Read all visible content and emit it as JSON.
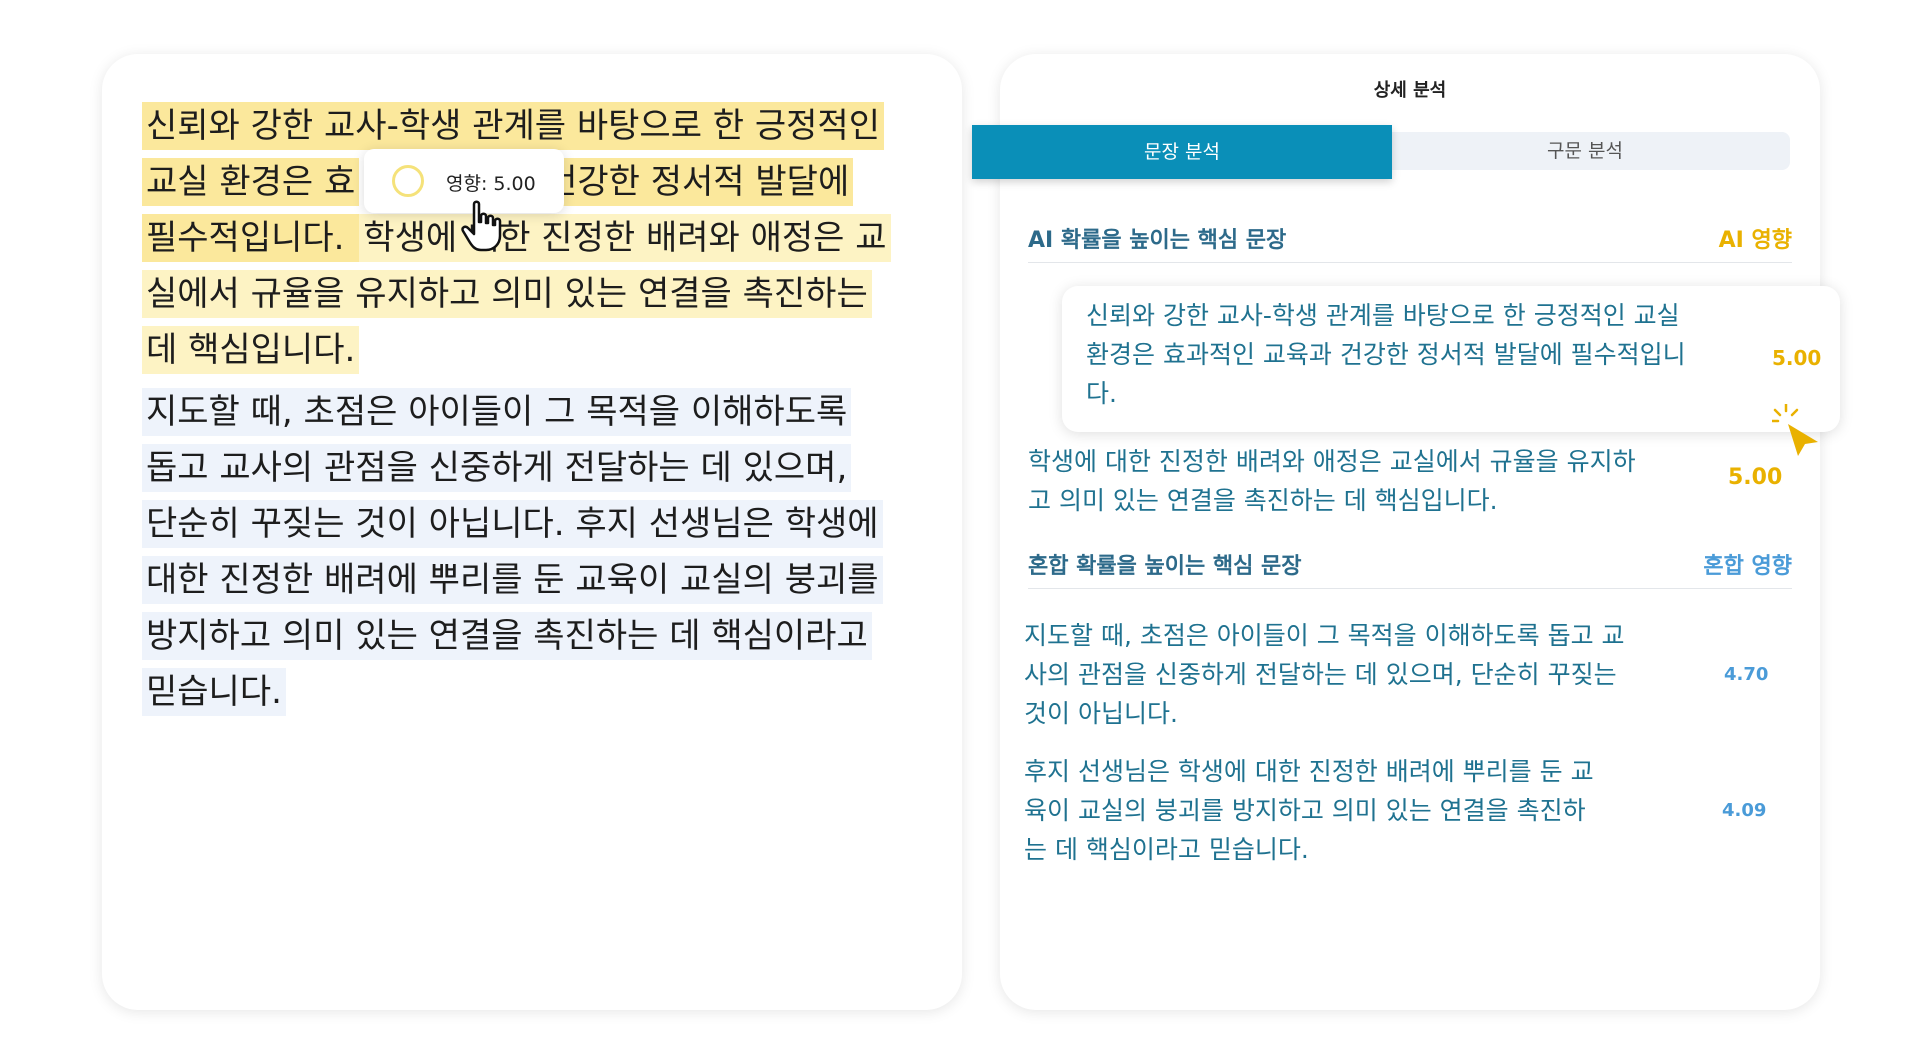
{
  "left": {
    "p1_lines": [
      [
        "신뢰와 강한 교사-학생 관계를 바탕으로 한 긍정적인"
      ],
      [
        "교실 환경은 효",
        "",
        " 건강한 정서적 발달에"
      ],
      [
        "필수적입니다. ",
        "학생에 대한 진정한 배려와 애정은 교"
      ],
      [
        "실에서 규율을 유지하고 의미 있는 연결을 촉진하는"
      ],
      [
        "데 핵심입니다."
      ]
    ],
    "p2_lines": [
      "지도할 때, 초점은 아이들이 그 목적을 이해하도록",
      "돕고 교사의 관점을 신중하게 전달하는 데 있으며,",
      "단순히 꾸짖는 것이 아닙니다. 후지 선생님은 학생에",
      "대한 진정한 배려에 뿌리를 둔 교육이 교실의 붕괴를",
      "방지하고 의미 있는 연결을 촉진하는 데 핵심이라고",
      "믿습니다. "
    ],
    "tooltip": "영향: 5.00"
  },
  "panel": {
    "title": "상세 분석",
    "tab_sentence": "문장 분석",
    "tab_syntax": "구문 분석",
    "section_ai": {
      "title": "AI 확률을 높이는 핵심 문장",
      "tag": "AI 영향"
    },
    "ai_rows": [
      {
        "lines": [
          "신뢰와 강한 교사-학생 관계를 바탕으로 한 긍정적인 교실",
          "환경은 효과적인 교육과 건강한 정서적 발달에 필수적입니",
          "다."
        ],
        "score": "5.00"
      },
      {
        "lines": [
          "학생에 대한 진정한 배려와 애정은 교실에서 규율을 유지하",
          "고 의미 있는 연결을 촉진하는 데 핵심입니다."
        ],
        "score": "5.00"
      }
    ],
    "section_mix": {
      "title": "혼합 확률을 높이는 핵심 문장",
      "tag": "혼합 영향"
    },
    "mix_rows": [
      {
        "lines": [
          "지도할 때, 초점은 아이들이 그 목적을 이해하도록 돕고 교",
          "사의 관점을 신중하게 전달하는 데 있으며, 단순히 꾸짖는",
          "것이 아닙니다."
        ],
        "score": "4.70"
      },
      {
        "lines": [
          " 후지 선생님은 학생에 대한 진정한 배려에 뿌리를 둔 교",
          "육이 교실의 붕괴를 방지하고 의미 있는 연결을 촉진하",
          "는 데 핵심이라고 믿습니다."
        ],
        "score": "4.09"
      }
    ]
  },
  "colors": {
    "accent_teal": "#0a8fb8",
    "ai_gold": "#e9b100",
    "mix_blue": "#4a9bd8",
    "text_teal": "#1f7290"
  }
}
